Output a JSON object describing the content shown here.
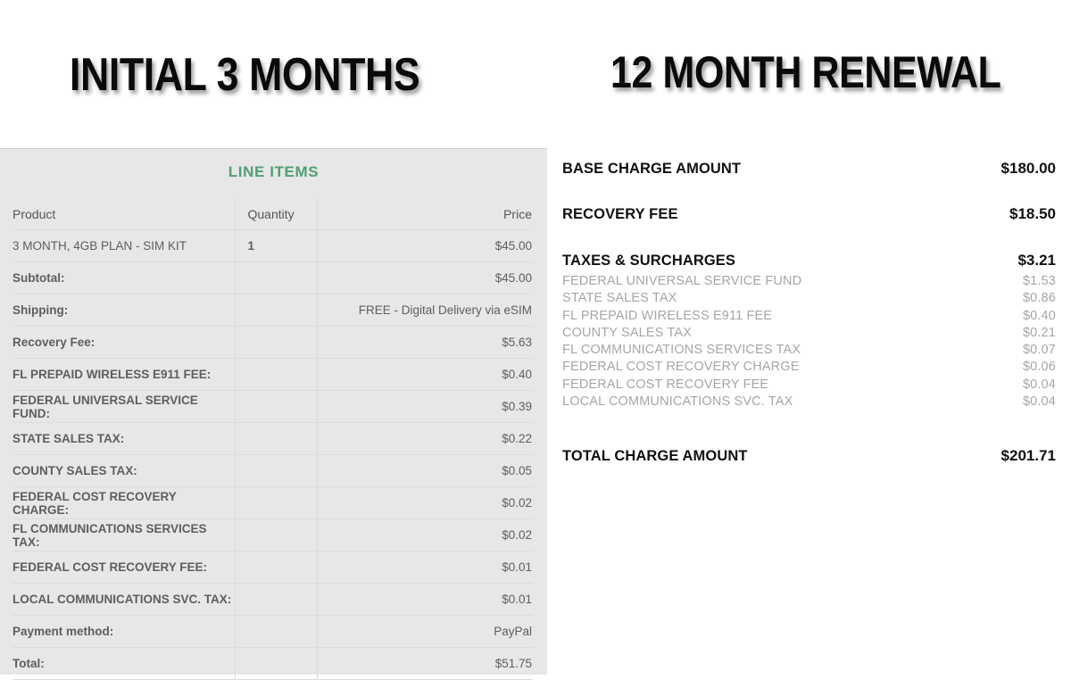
{
  "titles": {
    "left": "INITIAL 3 MONTHS",
    "right": "12 MONTH RENEWAL"
  },
  "left_panel": {
    "section_title": "LINE ITEMS",
    "accent_color": "#4ea074",
    "columns": {
      "product": "Product",
      "quantity": "Quantity",
      "price": "Price"
    },
    "product_rows": [
      {
        "product": "3 MONTH, 4GB PLAN - SIM KIT",
        "quantity": "1",
        "price": "$45.00"
      }
    ],
    "summary_rows": [
      {
        "label": "Subtotal:",
        "value": "$45.00"
      },
      {
        "label": "Shipping:",
        "value": "FREE - Digital Delivery via eSIM"
      },
      {
        "label": "Recovery Fee:",
        "value": "$5.63"
      },
      {
        "label": "FL PREPAID WIRELESS E911 FEE:",
        "value": "$0.40"
      },
      {
        "label": "FEDERAL UNIVERSAL SERVICE FUND:",
        "value": "$0.39"
      },
      {
        "label": "STATE SALES TAX:",
        "value": "$0.22"
      },
      {
        "label": "COUNTY SALES TAX:",
        "value": "$0.05"
      },
      {
        "label": "FEDERAL COST RECOVERY CHARGE:",
        "value": "$0.02"
      },
      {
        "label": "FL COMMUNICATIONS SERVICES TAX:",
        "value": "$0.02"
      },
      {
        "label": "FEDERAL COST RECOVERY FEE:",
        "value": "$0.01"
      },
      {
        "label": "LOCAL COMMUNICATIONS SVC. TAX:",
        "value": "$0.01"
      },
      {
        "label": "Payment method:",
        "value": "PayPal"
      },
      {
        "label": "Total:",
        "value": "$51.75"
      }
    ]
  },
  "right_panel": {
    "base_charge": {
      "label": "BASE CHARGE AMOUNT",
      "value": "$180.00"
    },
    "recovery_fee": {
      "label": "RECOVERY FEE",
      "value": "$18.50"
    },
    "taxes_surcharges": {
      "label": "TAXES & SURCHARGES",
      "value": "$3.21"
    },
    "tax_details": [
      {
        "label": "FEDERAL UNIVERSAL SERVICE FUND",
        "value": "$1.53"
      },
      {
        "label": "STATE SALES TAX",
        "value": "$0.86"
      },
      {
        "label": "FL PREPAID WIRELESS E911 FEE",
        "value": "$0.40"
      },
      {
        "label": "COUNTY SALES TAX",
        "value": "$0.21"
      },
      {
        "label": "FL COMMUNICATIONS SERVICES TAX",
        "value": "$0.07"
      },
      {
        "label": "FEDERAL COST RECOVERY CHARGE",
        "value": "$0.06"
      },
      {
        "label": "FEDERAL COST RECOVERY FEE",
        "value": "$0.04"
      },
      {
        "label": "LOCAL COMMUNICATIONS SVC. TAX",
        "value": "$0.04"
      }
    ],
    "total_charge": {
      "label": "TOTAL CHARGE AMOUNT",
      "value": "$201.71"
    }
  }
}
